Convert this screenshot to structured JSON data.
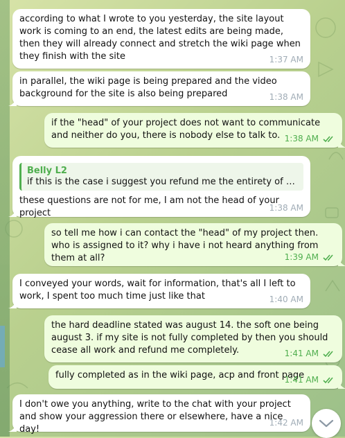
{
  "messages": [
    {
      "direction": "in",
      "text": "according to what I wrote to you yesterday, the site layout work is coming to an end, the latest edits are being made, then they will already connect and stretch the wiki page when they finish with the site",
      "time": "1:37 AM"
    },
    {
      "direction": "in",
      "text": "in parallel, the wiki page is being prepared and the video background for the site is also being prepared",
      "time": "1:38 AM"
    },
    {
      "direction": "out",
      "text": "if the \"head\" of your project does not want to communicate and neither do you, there is nobody else to talk to.",
      "time": "1:38 AM"
    },
    {
      "direction": "in",
      "reply_name": "Belly L2",
      "reply_text": "if this is the case i suggest you refund me the entirety of my pay...",
      "text": "these questions are not for me, I am not the head of your project",
      "time": "1:38 AM"
    },
    {
      "direction": "out",
      "text": "so tell me how i can contact the \"head\" of my project then. who is assigned to it? why i have i not heard anything from them at all?",
      "time": "1:39 AM"
    },
    {
      "direction": "in",
      "text": "I conveyed your words, wait for information, that's all I left to work, I spent too much time just like that",
      "time": "1:40 AM"
    },
    {
      "direction": "out",
      "text": "the hard deadline stated was august 14. the soft one being august 3. if my site is not fully completed by then you should cease all work and refund me completely.",
      "time": "1:41 AM"
    },
    {
      "direction": "out",
      "text": "fully completed as in the wiki page, acp and front page",
      "time": "1:41 AM"
    },
    {
      "direction": "in",
      "text": "I don't owe you anything, write to the chat with your project and show your aggression there or elsewhere, have a nice day!",
      "time": "1:42 AM"
    }
  ]
}
